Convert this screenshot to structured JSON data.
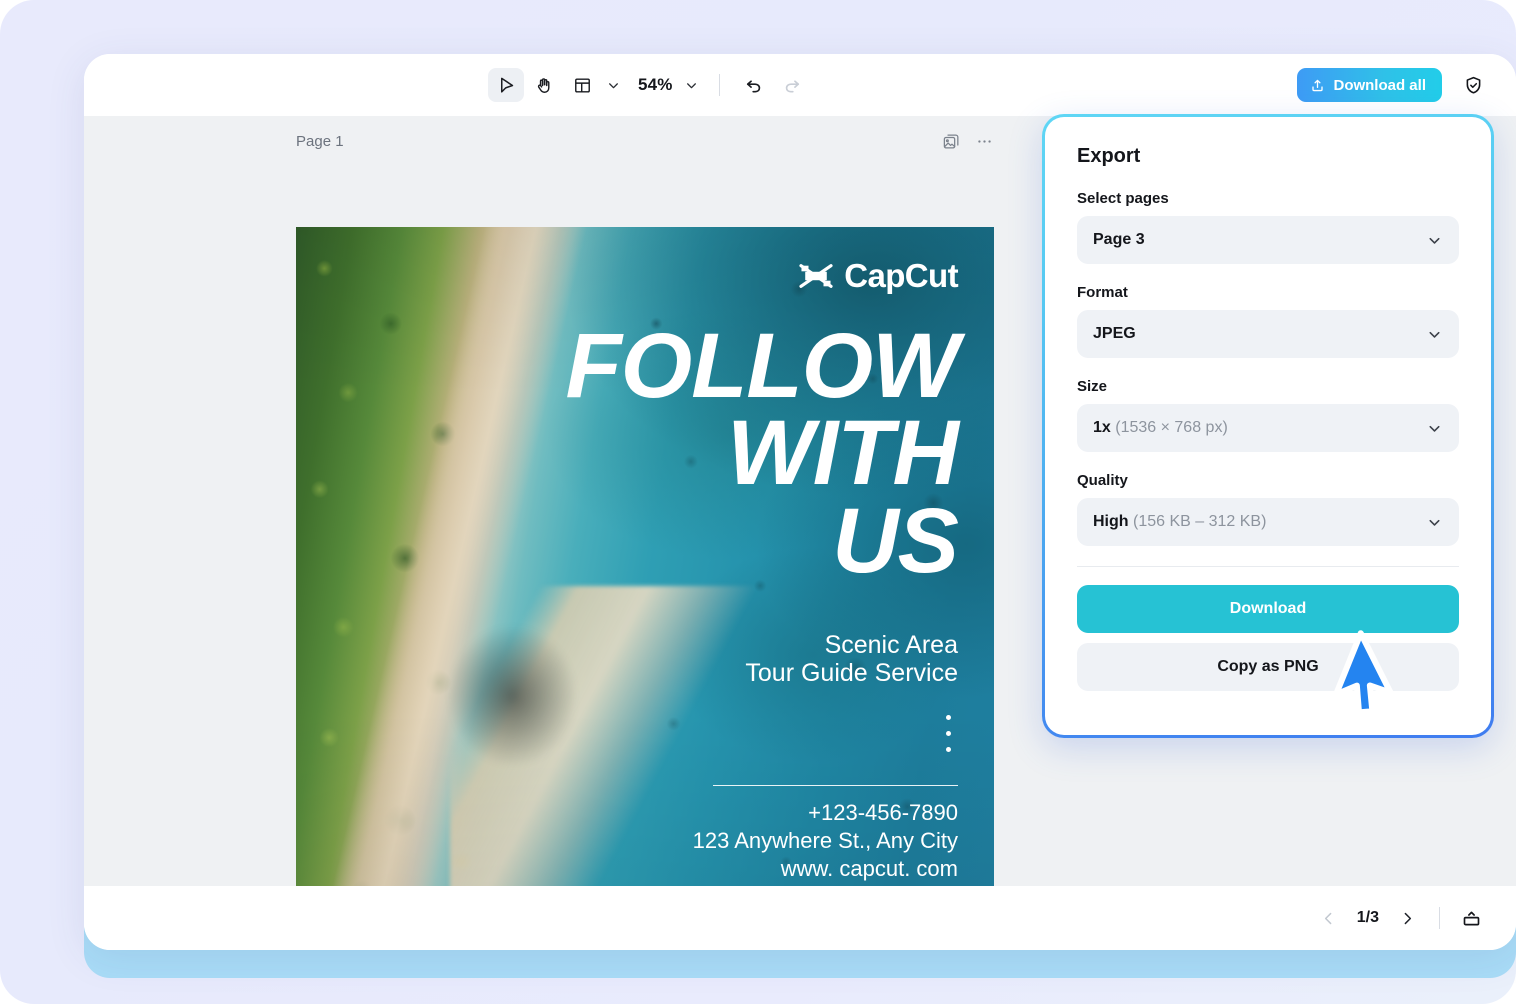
{
  "toolbar": {
    "tools": [
      {
        "name": "select-tool",
        "icon": "cursor-arrow-icon",
        "active": true
      },
      {
        "name": "hand-tool",
        "icon": "hand-icon",
        "active": false
      },
      {
        "name": "layout-tool",
        "icon": "layout-grid-icon",
        "active": false
      }
    ],
    "zoom_level": "54%",
    "undo_icon": "undo-arrow-icon",
    "redo_icon": "redo-arrow-icon",
    "download_all_label": "Download all",
    "download_all_icon": "upload-share-icon",
    "shield_icon": "shield-check-icon"
  },
  "canvas": {
    "page_label": "Page 1",
    "duplicate_icon": "duplicate-image-icon",
    "more_icon": "more-horizontal-icon"
  },
  "poster": {
    "brand": "CapCut",
    "brand_icon": "capcut-logo-icon",
    "heading_lines": [
      "FOLLOW",
      "WITH",
      "US"
    ],
    "subtitle_lines": [
      "Scenic Area",
      "Tour Guide Service"
    ],
    "contact_lines": [
      "+123-456-7890",
      "123 Anywhere St., Any City",
      "www. capcut. com"
    ]
  },
  "export": {
    "title": "Export",
    "fields": [
      {
        "label": "Select pages",
        "value": "Page 3",
        "value_muted": ""
      },
      {
        "label": "Format",
        "value": "JPEG",
        "value_muted": ""
      },
      {
        "label": "Size",
        "value": "1x",
        "value_muted": "(1536 × 768 px)"
      },
      {
        "label": "Quality",
        "value": "High",
        "value_muted": "(156 KB – 312 KB)"
      }
    ],
    "download_label": "Download",
    "copy_label": "Copy as PNG",
    "accent_color": "#26c2d4",
    "border_gradient_from": "#5fd6f5",
    "border_gradient_to": "#3f7cf0"
  },
  "statusbar": {
    "prev_icon": "chevron-left-icon",
    "page_indicator": "1/3",
    "next_icon": "chevron-right-icon",
    "panel_toggle_icon": "panel-toggle-icon"
  },
  "cursor": {
    "icon": "mouse-pointer-icon",
    "color": "#2484f0"
  }
}
